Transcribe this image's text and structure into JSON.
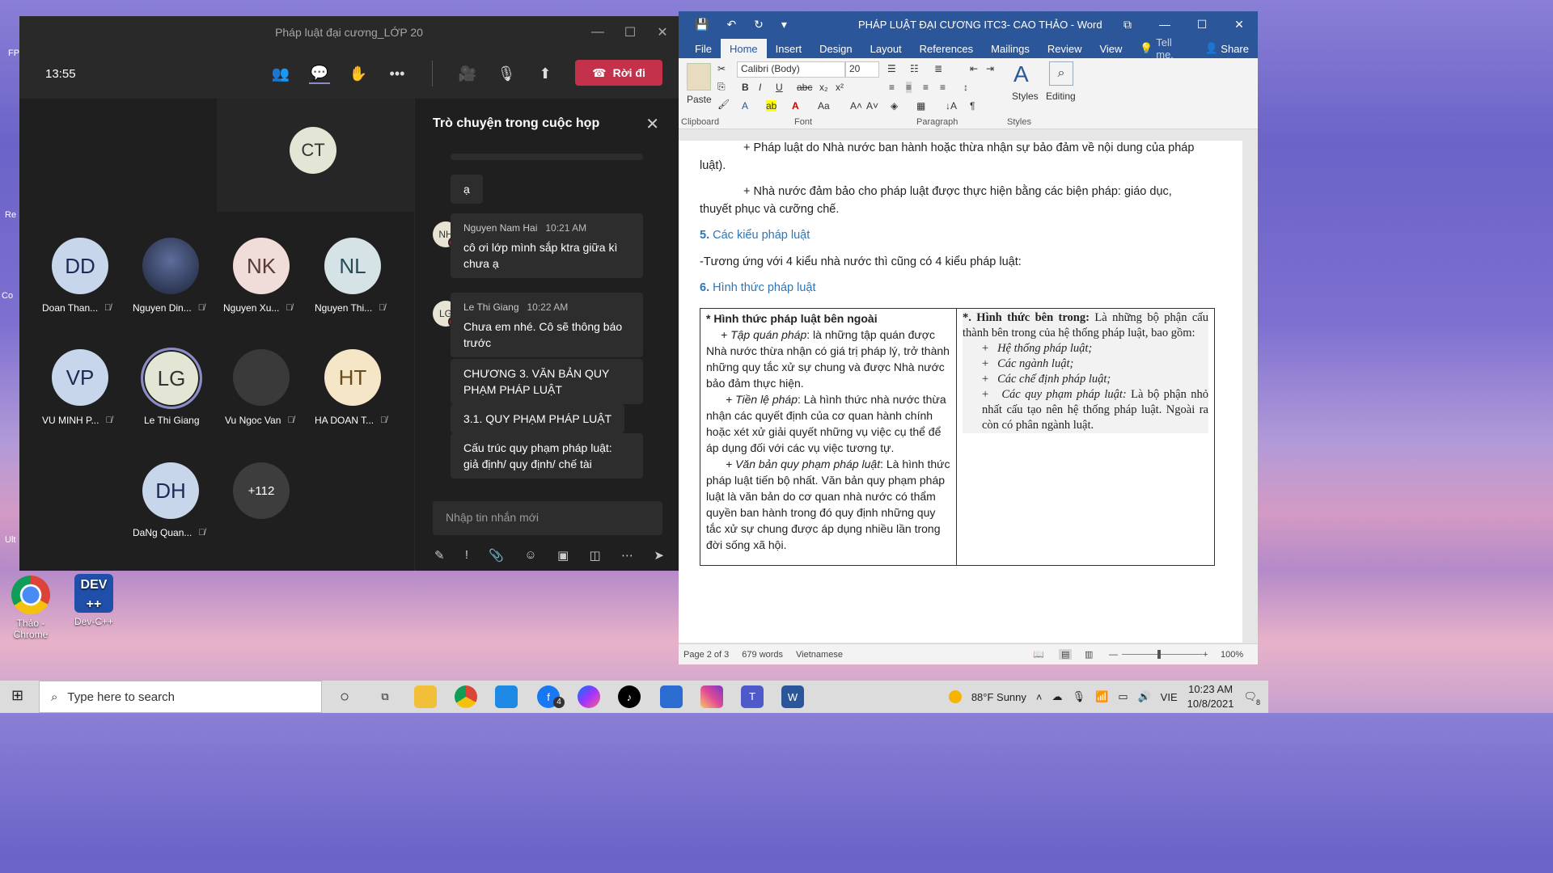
{
  "desktop": {
    "icons": [
      {
        "label": "Thảo - Chrome"
      },
      {
        "label": "Dev-C++"
      }
    ],
    "edge_labels": [
      "FP",
      "Re",
      "Co",
      "Ult"
    ]
  },
  "teams": {
    "window_title": "Pháp luật đại cương_LỚP 20",
    "clock": "13:55",
    "leave_label": "Rời đi",
    "featured": {
      "initials": "CT"
    },
    "participants": [
      {
        "initials": "DD",
        "name": "Doan Than...",
        "color": "#c7d6ea"
      },
      {
        "initials": "",
        "name": "Nguyen Din...",
        "color": "#26304a"
      },
      {
        "initials": "NK",
        "name": "Nguyen Xu...",
        "color": "#f0dcd8"
      },
      {
        "initials": "NL",
        "name": "Nguyen Thi...",
        "color": "#d6e3e6"
      },
      {
        "initials": "VP",
        "name": "VU MINH P...",
        "color": "#c7d6ea"
      },
      {
        "initials": "LG",
        "name": "Le Thi Giang",
        "color": "#e3e6d4"
      },
      {
        "initials": "",
        "name": "Vu Ngoc Van",
        "color": "#3a3a3a"
      },
      {
        "initials": "HT",
        "name": "HA DOAN T...",
        "color": "#f5e6c8"
      },
      {
        "initials": "DH",
        "name": "DaNg Quan...",
        "color": "#c7d6ea"
      }
    ],
    "overflow_count": "+112",
    "chat": {
      "title": "Trò chuyện trong cuộc họp",
      "partial_msg": "ạ",
      "messages": [
        {
          "avatar": "NH",
          "author": "Nguyen Nam Hai",
          "time": "10:21 AM",
          "text": "cô ơi lớp mình sắp ktra giữa kì chưa ạ"
        },
        {
          "avatar": "LG",
          "author": "Le Thi Giang",
          "time": "10:22 AM",
          "text": "Chưa em nhé. Cô sẽ thông báo trước"
        }
      ],
      "followups": [
        "CHƯƠNG 3. VĂN BẢN QUY PHẠM PHÁP LUẬT",
        "3.1. QUY PHẠM PHÁP LUẬT",
        "Cấu trúc quy phạm pháp luật: giả định/ quy định/ chế tài"
      ],
      "input_placeholder": "Nhập tin nhắn mới"
    }
  },
  "word": {
    "title": "PHÁP LUẬT ĐẠI CƯƠNG ITC3- CAO THẢO - Word",
    "tabs": [
      "File",
      "Home",
      "Insert",
      "Design",
      "Layout",
      "References",
      "Mailings",
      "Review",
      "View"
    ],
    "tell_me": "Tell me.",
    "share": "Share",
    "font_name": "Calibri (Body)",
    "font_size": "20",
    "paste_label": "Paste",
    "styles_label": "Styles",
    "editing_label": "Editing",
    "groups": [
      "Clipboard",
      "Font",
      "Paragraph",
      "Styles"
    ],
    "doc": {
      "p1a": "+ Pháp luật do Nhà nước ban hành hoặc thừa nhận sự bảo đảm về nội dung của pháp",
      "p1b": "luật).",
      "p2a": "+ Nhà nước đảm bảo cho pháp luật được thực hiện bằng các biện pháp: giáo dục,",
      "p2b": "thuyết phục và cưỡng chế.",
      "h5_num": "5.",
      "h5": "Các kiểu pháp luật",
      "p3": "-Tương ứng với 4 kiểu nhà nước thì cũng có 4 kiểu pháp luật:",
      "h6_num": "6.",
      "h6": "Hình thức pháp luật",
      "col1_title": "* Hình thức pháp luật bên ngoài",
      "col1_a_label": "+ Tập quán pháp",
      "col1_a": ": là những tập quán được Nhà nước thừa nhận có giá trị pháp lý, trở thành những quy tắc xử sự chung và được Nhà nước bảo đảm thực hiện.",
      "col1_b_label": "+ Tiền lệ pháp",
      "col1_b": ": Là hình thức nhà nước thừa nhận các quyết định của cơ quan hành chính hoặc xét xử giải quyết những vụ việc cụ thể để áp dụng đối với các vụ việc tương tự.",
      "col1_c_label": "+ Văn bản quy phạm pháp luật",
      "col1_c": ": Là hình thức pháp luật tiến bộ nhất. Văn bản quy phạm pháp luật là văn bản do cơ quan nhà nước có thẩm quyền ban hành trong đó quy định những quy tắc xử sự chung được áp dụng nhiều lần trong đời sống xã hội.",
      "col2_title": "*. Hình thức bên trong:",
      "col2_intro": " Là những bộ phận cấu thành bên trong của hệ thống pháp luật, bao gồm:",
      "col2_items": [
        "Hệ thống pháp luật;",
        "Các ngành luật;",
        "Các chế định pháp luật;"
      ],
      "col2_last_label": "Các quy phạm pháp luật:",
      "col2_last": " Là bộ phận nhỏ nhất cấu tạo nên hệ thống pháp luật. Ngoài ra còn có phân ngành luật."
    },
    "status": {
      "page": "Page 2 of 3",
      "words": "679 words",
      "lang": "Vietnamese",
      "zoom": "100%"
    }
  },
  "taskbar": {
    "search_placeholder": "Type here to search",
    "weather": "88°F  Sunny",
    "lang": "VIE",
    "time": "10:23 AM",
    "date": "10/8/2021",
    "badge": "4",
    "notif": "8"
  }
}
